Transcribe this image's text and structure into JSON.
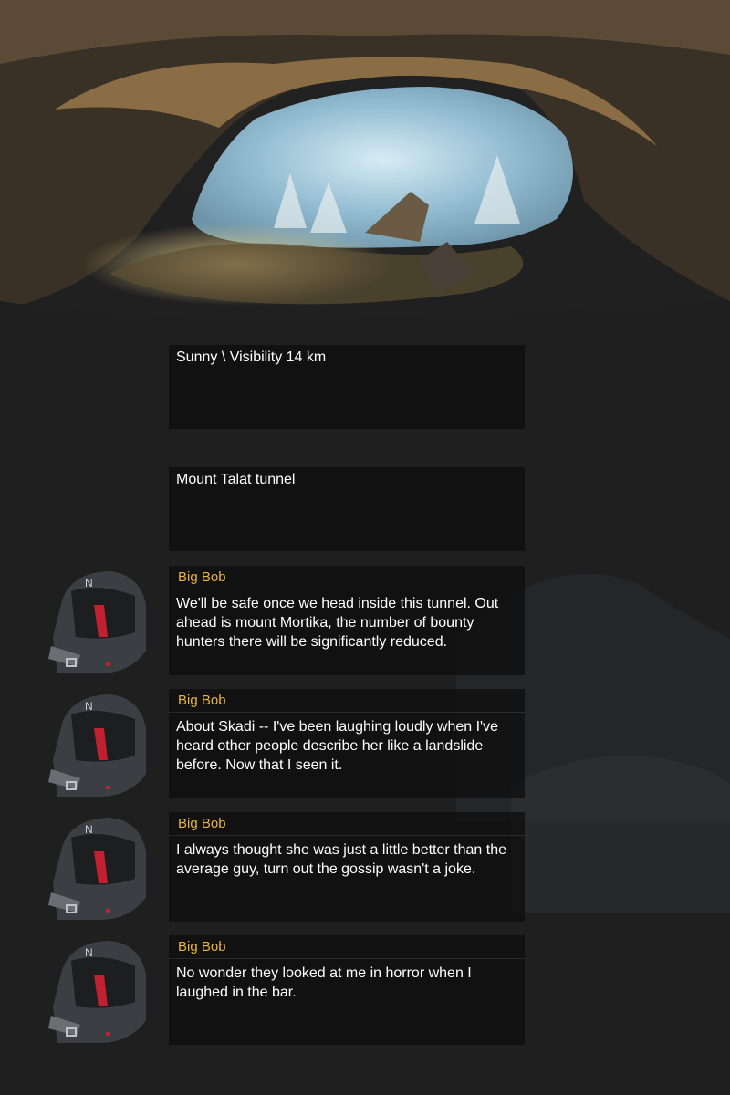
{
  "scene": {
    "name": "cave-entrance-background"
  },
  "narration": [
    {
      "text": "Sunny \\ Visibility 14 km"
    },
    {
      "text": "Mount Talat tunnel"
    }
  ],
  "dialogs": [
    {
      "speaker": "Big Bob",
      "text": "We'll be safe once we head inside this tunnel. Out ahead is mount Mortika, the number of bounty hunters there will be significantly reduced."
    },
    {
      "speaker": "Big Bob",
      "text": "About Skadi -- I've been laughing loudly when I've heard other people describe her like a landslide before. Now that I seen it."
    },
    {
      "speaker": "Big Bob",
      "text": "I always thought she was just a little better than the average guy, turn out the gossip wasn't a joke."
    },
    {
      "speaker": "Big Bob",
      "text": "No wonder they looked at me in horror when I laughed in the bar."
    }
  ],
  "colors": {
    "speaker": "#e9b43a",
    "text": "#ffffff",
    "panel": "#0c0c0c"
  }
}
